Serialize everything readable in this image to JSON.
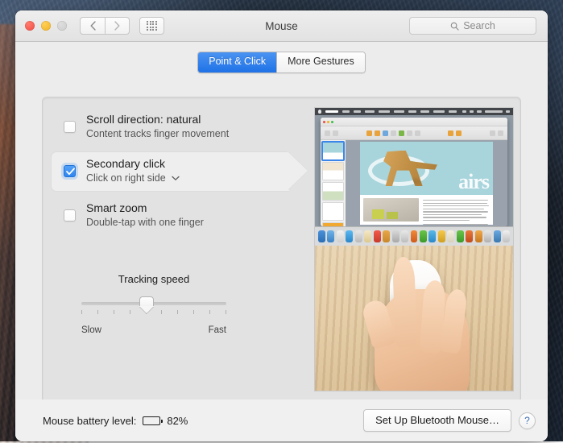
{
  "window": {
    "title": "Mouse",
    "traffic_lights": [
      "close",
      "minimize",
      "zoom"
    ],
    "nav": {
      "back_icon": "chevron-left-icon",
      "forward_icon": "chevron-right-icon"
    },
    "grid_icon": "grid-view-icon"
  },
  "search": {
    "placeholder": "Search",
    "value": "",
    "icon": "search-icon"
  },
  "tabs": [
    {
      "label": "Point & Click",
      "active": true
    },
    {
      "label": "More Gestures",
      "active": false
    }
  ],
  "options": [
    {
      "title": "Scroll direction: natural",
      "subtitle": "Content tracks finger movement",
      "checked": false,
      "selected": false,
      "has_dropdown": false
    },
    {
      "title": "Secondary click",
      "subtitle": "Click on right side",
      "checked": true,
      "selected": true,
      "has_dropdown": true,
      "dropdown_icon": "chevron-down-icon"
    },
    {
      "title": "Smart zoom",
      "subtitle": "Double-tap with one finger",
      "checked": false,
      "selected": false,
      "has_dropdown": false
    }
  ],
  "tracking": {
    "label": "Tracking speed",
    "min_label": "Slow",
    "max_label": "Fast",
    "value_percent": 45,
    "tick_count": 10
  },
  "preview": {
    "top_caption": "pages-document-screenshot",
    "bottom_caption": "hand-on-magic-mouse-photo"
  },
  "footer": {
    "battery_label": "Mouse battery level:",
    "battery_value": "82%",
    "battery_percent": 82,
    "battery_icon": "battery-icon",
    "setup_button": "Set Up Bluetooth Mouse…",
    "help_button": "?"
  },
  "colors": {
    "accent_blue": "#2f86f0",
    "tab_active_blue": "#2d7ce8",
    "window_chrome": "#ececec",
    "panel_bg": "#e2e2e2",
    "footer_bg": "#f0f0f0",
    "help_blue": "#3f6fb5"
  }
}
